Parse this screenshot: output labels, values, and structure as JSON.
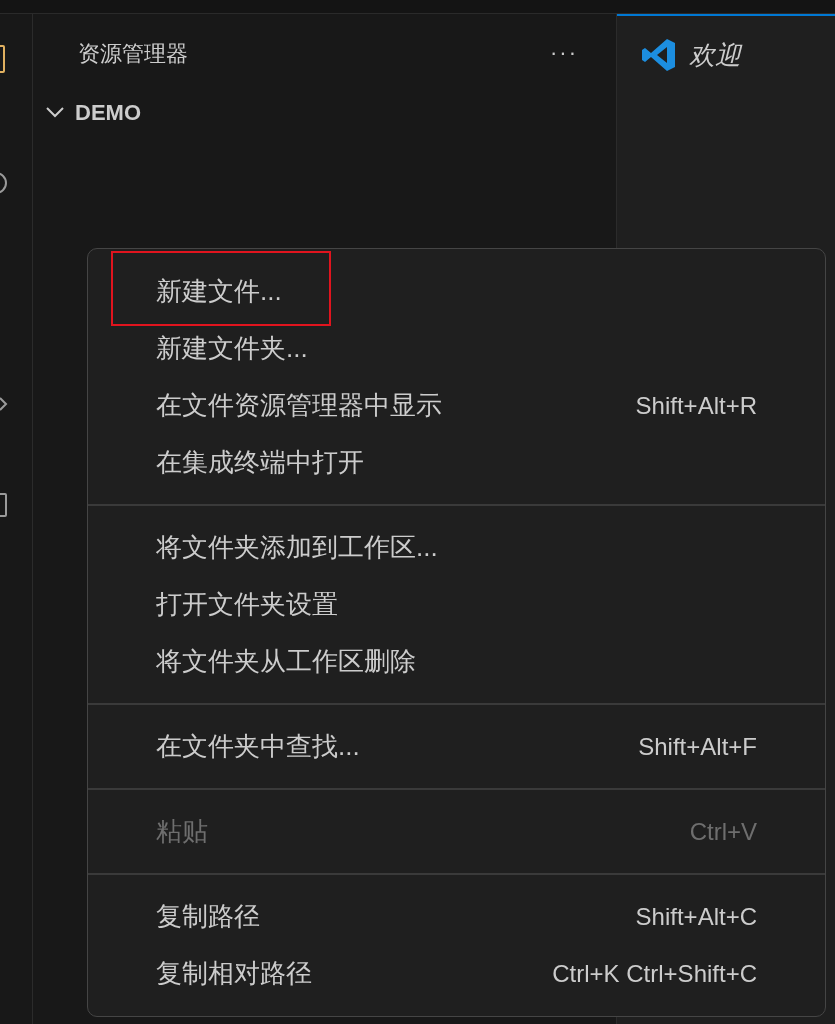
{
  "sidebar": {
    "title": "资源管理器",
    "more": "···",
    "folder": {
      "label": "DEMO",
      "expanded": true
    }
  },
  "editor_tab": {
    "label": "欢迎",
    "selected": true
  },
  "context_menu": {
    "groups": [
      {
        "items": [
          {
            "label": "新建文件...",
            "disabled": false,
            "highlighted": true
          },
          {
            "label": "新建文件夹...",
            "disabled": false,
            "highlighted": false
          },
          {
            "label": "在文件资源管理器中显示",
            "shortcut": "Shift+Alt+R",
            "disabled": false,
            "highlighted": false
          },
          {
            "label": "在集成终端中打开",
            "disabled": false,
            "highlighted": false
          }
        ]
      },
      {
        "items": [
          {
            "label": "将文件夹添加到工作区...",
            "disabled": false,
            "highlighted": false
          },
          {
            "label": "打开文件夹设置",
            "disabled": false,
            "highlighted": false
          },
          {
            "label": "将文件夹从工作区删除",
            "disabled": false,
            "highlighted": false
          }
        ]
      },
      {
        "items": [
          {
            "label": "在文件夹中查找...",
            "shortcut": "Shift+Alt+F",
            "disabled": false,
            "highlighted": false
          }
        ]
      },
      {
        "items": [
          {
            "label": "粘贴",
            "shortcut": "Ctrl+V",
            "disabled": true,
            "highlighted": false
          }
        ]
      },
      {
        "items": [
          {
            "label": "复制路径",
            "shortcut": "Shift+Alt+C",
            "disabled": false,
            "highlighted": false
          },
          {
            "label": "复制相对路径",
            "shortcut": "Ctrl+K Ctrl+Shift+C",
            "disabled": false,
            "highlighted": false
          }
        ]
      }
    ]
  }
}
